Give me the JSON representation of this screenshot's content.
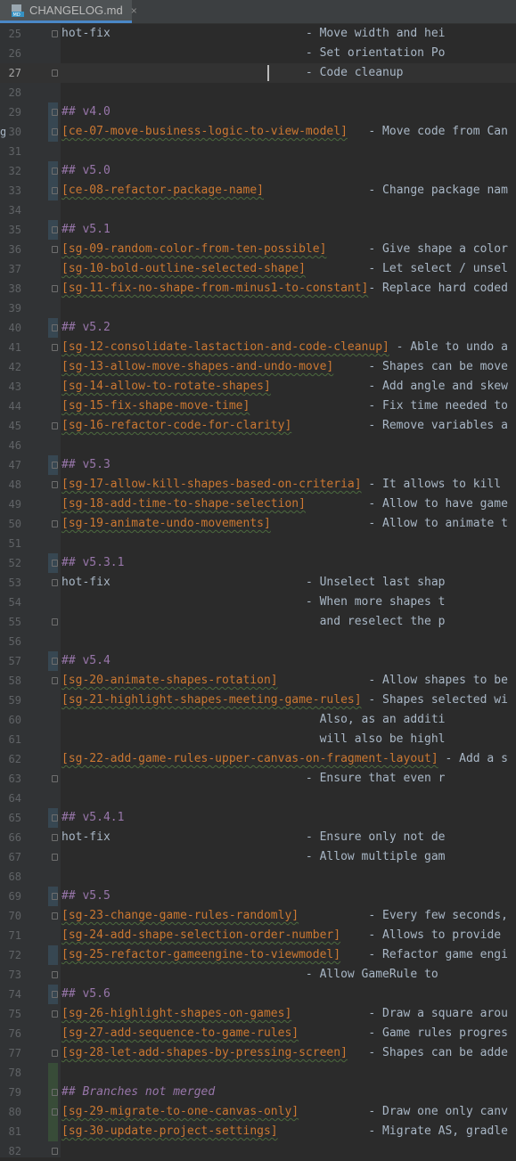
{
  "tab": {
    "label": "CHANGELOG.md",
    "close": "×",
    "icon": "markdown-file-icon",
    "icon_text": "MD"
  },
  "lines": [
    {
      "num": "25",
      "segments": [
        {
          "t": "hot-fix",
          "c": "text"
        },
        {
          "t": "                            - Move width and hei",
          "c": "text"
        }
      ],
      "fold": true
    },
    {
      "num": "26",
      "segments": [
        {
          "t": "                                   - Set orientation Po",
          "c": "text"
        }
      ]
    },
    {
      "num": "27",
      "segments": [
        {
          "t": "                                   - Code cleanup",
          "c": "text"
        }
      ],
      "fold": true,
      "current": true
    },
    {
      "num": "28",
      "segments": []
    },
    {
      "num": "29",
      "segments": [
        {
          "t": "## v4.0",
          "c": "head"
        }
      ],
      "fold": true,
      "change": "blue"
    },
    {
      "num": "30",
      "segments": [
        {
          "t": "[ce-07-move-business-logic-to-view-model]",
          "c": "link"
        },
        {
          "t": "   - Move code from Can",
          "c": "text"
        }
      ],
      "fold": true,
      "change": "blue",
      "leftmark": "g"
    },
    {
      "num": "31",
      "segments": []
    },
    {
      "num": "32",
      "segments": [
        {
          "t": "## v5.0",
          "c": "head"
        }
      ],
      "fold": true,
      "change": "blue"
    },
    {
      "num": "33",
      "segments": [
        {
          "t": "[ce-08-refactor-package-name]",
          "c": "link"
        },
        {
          "t": "               - Change package nam",
          "c": "text"
        }
      ],
      "fold": true,
      "change": "blue"
    },
    {
      "num": "34",
      "segments": []
    },
    {
      "num": "35",
      "segments": [
        {
          "t": "## v5.1",
          "c": "head"
        }
      ],
      "fold": true,
      "change": "blue"
    },
    {
      "num": "36",
      "segments": [
        {
          "t": "[sg-09-random-color-from-ten-possible]",
          "c": "link"
        },
        {
          "t": "      - Give shape a color",
          "c": "text"
        }
      ],
      "fold": true
    },
    {
      "num": "37",
      "segments": [
        {
          "t": "[sg-10-bold-outline-selected-shape]",
          "c": "link"
        },
        {
          "t": "         - Let select / unsel",
          "c": "text"
        }
      ]
    },
    {
      "num": "38",
      "segments": [
        {
          "t": "[sg-11-fix-no-shape-from-minus1-to-constant]",
          "c": "link"
        },
        {
          "t": "- Replace hard coded",
          "c": "text"
        }
      ],
      "fold": true
    },
    {
      "num": "39",
      "segments": []
    },
    {
      "num": "40",
      "segments": [
        {
          "t": "## v5.2",
          "c": "head"
        }
      ],
      "fold": true,
      "change": "blue"
    },
    {
      "num": "41",
      "segments": [
        {
          "t": "[sg-12-consolidate-lastaction-and-code-cleanup]",
          "c": "link"
        },
        {
          "t": " - Able to undo a",
          "c": "text"
        }
      ],
      "fold": true
    },
    {
      "num": "42",
      "segments": [
        {
          "t": "[sg-13-allow-move-shapes-and-undo-move]",
          "c": "link"
        },
        {
          "t": "     - Shapes can be move",
          "c": "text"
        }
      ]
    },
    {
      "num": "43",
      "segments": [
        {
          "t": "[sg-14-allow-to-rotate-shapes]",
          "c": "link"
        },
        {
          "t": "              - Add angle and skew",
          "c": "text"
        }
      ]
    },
    {
      "num": "44",
      "segments": [
        {
          "t": "[sg-15-fix-shape-move-time]",
          "c": "link"
        },
        {
          "t": "                 - Fix time needed to",
          "c": "text"
        }
      ]
    },
    {
      "num": "45",
      "segments": [
        {
          "t": "[sg-16-refactor-code-for-clarity]",
          "c": "link"
        },
        {
          "t": "           - Remove variables a",
          "c": "text"
        }
      ],
      "fold": true
    },
    {
      "num": "46",
      "segments": []
    },
    {
      "num": "47",
      "segments": [
        {
          "t": "## v5.3",
          "c": "head"
        }
      ],
      "fold": true,
      "change": "blue"
    },
    {
      "num": "48",
      "segments": [
        {
          "t": "[sg-17-allow-kill-shapes-based-on-criteria]",
          "c": "link"
        },
        {
          "t": " - It allows to kill",
          "c": "text"
        }
      ],
      "fold": true
    },
    {
      "num": "49",
      "segments": [
        {
          "t": "[sg-18-add-time-to-shape-selection]",
          "c": "link"
        },
        {
          "t": "         - Allow to have game",
          "c": "text"
        }
      ]
    },
    {
      "num": "50",
      "segments": [
        {
          "t": "[sg-19-animate-undo-movements]",
          "c": "link"
        },
        {
          "t": "              - Allow to animate t",
          "c": "text"
        }
      ],
      "fold": true
    },
    {
      "num": "51",
      "segments": []
    },
    {
      "num": "52",
      "segments": [
        {
          "t": "## v5.3.1",
          "c": "head"
        }
      ],
      "fold": true,
      "change": "blue"
    },
    {
      "num": "53",
      "segments": [
        {
          "t": "hot-fix",
          "c": "text"
        },
        {
          "t": "                            - Unselect last shap",
          "c": "text"
        }
      ],
      "fold": true
    },
    {
      "num": "54",
      "segments": [
        {
          "t": "                                   - When more shapes t",
          "c": "text"
        }
      ]
    },
    {
      "num": "55",
      "segments": [
        {
          "t": "                                     and reselect the p",
          "c": "text"
        }
      ],
      "fold": true
    },
    {
      "num": "56",
      "segments": []
    },
    {
      "num": "57",
      "segments": [
        {
          "t": "## v5.4",
          "c": "head"
        }
      ],
      "fold": true,
      "change": "blue"
    },
    {
      "num": "58",
      "segments": [
        {
          "t": "[sg-20-animate-shapes-rotation]",
          "c": "link"
        },
        {
          "t": "             - Allow shapes to be",
          "c": "text"
        }
      ],
      "fold": true
    },
    {
      "num": "59",
      "segments": [
        {
          "t": "[sg-21-highlight-shapes-meeting-game-rules]",
          "c": "link"
        },
        {
          "t": " - Shapes selected wi",
          "c": "text"
        }
      ]
    },
    {
      "num": "60",
      "segments": [
        {
          "t": "                                     Also, as an additi",
          "c": "text"
        }
      ]
    },
    {
      "num": "61",
      "segments": [
        {
          "t": "                                     will also be highl",
          "c": "text"
        }
      ]
    },
    {
      "num": "62",
      "segments": [
        {
          "t": "[sg-22-add-game-rules-upper-canvas-on-fragment-layout]",
          "c": "link"
        },
        {
          "t": " - Add a s",
          "c": "text"
        }
      ]
    },
    {
      "num": "63",
      "segments": [
        {
          "t": "                                   - Ensure that even r",
          "c": "text"
        }
      ],
      "fold": true
    },
    {
      "num": "64",
      "segments": []
    },
    {
      "num": "65",
      "segments": [
        {
          "t": "## v5.4.1",
          "c": "head"
        }
      ],
      "fold": true,
      "change": "blue"
    },
    {
      "num": "66",
      "segments": [
        {
          "t": "hot-fix",
          "c": "text"
        },
        {
          "t": "                            - Ensure only not de",
          "c": "text"
        }
      ],
      "fold": true
    },
    {
      "num": "67",
      "segments": [
        {
          "t": "                                   - Allow multiple gam",
          "c": "text"
        }
      ],
      "fold": true
    },
    {
      "num": "68",
      "segments": []
    },
    {
      "num": "69",
      "segments": [
        {
          "t": "## v5.5",
          "c": "head"
        }
      ],
      "fold": true,
      "change": "blue"
    },
    {
      "num": "70",
      "segments": [
        {
          "t": "[sg-23-change-game-rules-randomly]",
          "c": "link"
        },
        {
          "t": "          - Every few seconds,",
          "c": "text"
        }
      ],
      "fold": true
    },
    {
      "num": "71",
      "segments": [
        {
          "t": "[sg-24-add-shape-selection-order-number]",
          "c": "link"
        },
        {
          "t": "    - Allows to provide",
          "c": "text"
        }
      ]
    },
    {
      "num": "72",
      "segments": [
        {
          "t": "[sg-25-refactor-gameengine-to-viewmodel]",
          "c": "link"
        },
        {
          "t": "    - Refactor game engi",
          "c": "text"
        }
      ],
      "change": "blue"
    },
    {
      "num": "73",
      "segments": [
        {
          "t": "                                   - Allow GameRule to",
          "c": "text"
        }
      ],
      "fold": true
    },
    {
      "num": "74",
      "segments": [
        {
          "t": "## v5.6",
          "c": "head"
        }
      ],
      "fold": true,
      "change": "blue"
    },
    {
      "num": "75",
      "segments": [
        {
          "t": "[sg-26-highlight-shapes-on-games]",
          "c": "link"
        },
        {
          "t": "           - Draw a square arou",
          "c": "text"
        }
      ],
      "fold": true
    },
    {
      "num": "76",
      "segments": [
        {
          "t": "[sg-27-add-sequence-to-game-rules]",
          "c": "link"
        },
        {
          "t": "          - Game rules progres",
          "c": "text"
        }
      ]
    },
    {
      "num": "77",
      "segments": [
        {
          "t": "[sg-28-let-add-shapes-by-pressing-screen]",
          "c": "link"
        },
        {
          "t": "   - Shapes can be adde",
          "c": "text"
        }
      ],
      "fold": true
    },
    {
      "num": "78",
      "segments": [],
      "change": "green"
    },
    {
      "num": "79",
      "segments": [
        {
          "t": "## Branches not merged",
          "c": "ital"
        }
      ],
      "fold": true,
      "change": "green"
    },
    {
      "num": "80",
      "segments": [
        {
          "t": "[sg-29-migrate-to-one-canvas-only]",
          "c": "link"
        },
        {
          "t": "          - Draw one only canv",
          "c": "text"
        }
      ],
      "fold": true,
      "change": "green"
    },
    {
      "num": "81",
      "segments": [
        {
          "t": "[sg-30-update-project-settings]",
          "c": "link"
        },
        {
          "t": "             - Migrate AS, gradle",
          "c": "text"
        }
      ],
      "change": "green"
    },
    {
      "num": "82",
      "segments": [],
      "fold": true
    }
  ]
}
